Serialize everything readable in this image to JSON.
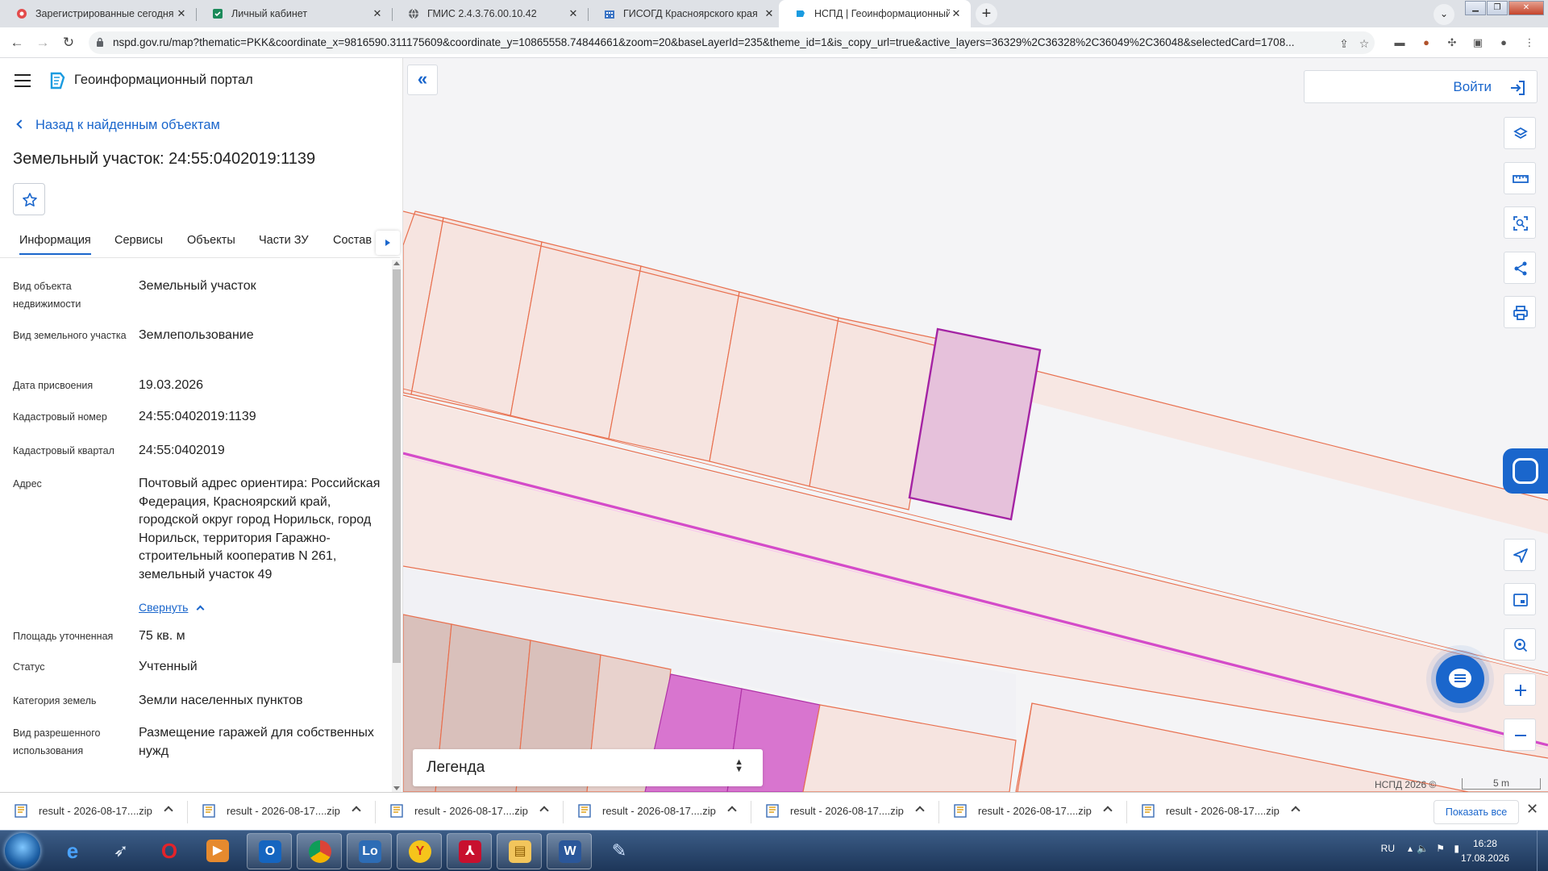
{
  "browser": {
    "tabs": [
      {
        "title": "Зарегистрированные сегодня",
        "active": false
      },
      {
        "title": "Личный кабинет",
        "active": false
      },
      {
        "title": "ГМИС 2.4.3.76.00.10.42",
        "active": false
      },
      {
        "title": "ГИСОГД Красноярского края",
        "active": false
      },
      {
        "title": "НСПД | Геоинформационный по",
        "active": true
      }
    ],
    "url": "nspd.gov.ru/map?thematic=PKK&coordinate_x=9816590.311175609&coordinate_y=10865558.74844661&zoom=20&baseLayerId=235&theme_id=1&is_copy_url=true&active_layers=36329%2C36328%2C36049%2C36048&selectedCard=1708..."
  },
  "portal": {
    "title": "Геоинформационный портал",
    "back_link": "Назад к найденным объектам",
    "object_title": "Земельный участок: 24:55:0402019:1139",
    "tabs": [
      "Информация",
      "Сервисы",
      "Объекты",
      "Части ЗУ",
      "Состав"
    ],
    "properties": [
      {
        "label": "Вид объекта недвижимости",
        "value": "Земельный участок"
      },
      {
        "label": "Вид земельного участка",
        "value": "Землепользование"
      },
      {
        "label": "Дата присвоения",
        "value": "19.03.2026"
      },
      {
        "label": "Кадастровый номер",
        "value": "24:55:0402019:1139"
      },
      {
        "label": "Кадастровый квартал",
        "value": "24:55:0402019"
      },
      {
        "label": "Адрес",
        "value": "Почтовый адрес ориентира: Российская Федерация, Красноярский край, городской округ город Норильск, город Норильск, территория Гаражно-строительный кооператив N 261, земельный участок 49"
      },
      {
        "label": "Площадь уточненная",
        "value": "75 кв. м"
      },
      {
        "label": "Статус",
        "value": "Учтенный"
      },
      {
        "label": "Категория земель",
        "value": "Земли населенных пунктов"
      },
      {
        "label": "Вид разрешенного использования",
        "value": "Размещение гаражей для собственных нужд"
      }
    ],
    "collapse_label": "Свернуть"
  },
  "map": {
    "login_label": "Войти",
    "legend_label": "Легенда",
    "attribution": "НСПД 2026 ©",
    "scale_label": "5 m",
    "colors": {
      "parcel_line": "#e8704f",
      "parcel_fill": "#f6e4e0",
      "selected_fill": "#e6c1db",
      "selected_line": "#a423a4",
      "highlight_fill": "#d875cf",
      "road_line": "#d44bc9"
    }
  },
  "downloads": {
    "items": [
      "result - 2026-08-17....zip",
      "result - 2026-08-17....zip",
      "result - 2026-08-17....zip",
      "result - 2026-08-17....zip",
      "result - 2026-08-17....zip",
      "result - 2026-08-17....zip",
      "result - 2026-08-17....zip"
    ],
    "show_all": "Показать все"
  },
  "taskbar": {
    "language": "RU",
    "time": "16:28",
    "date": "17.08.2026"
  }
}
